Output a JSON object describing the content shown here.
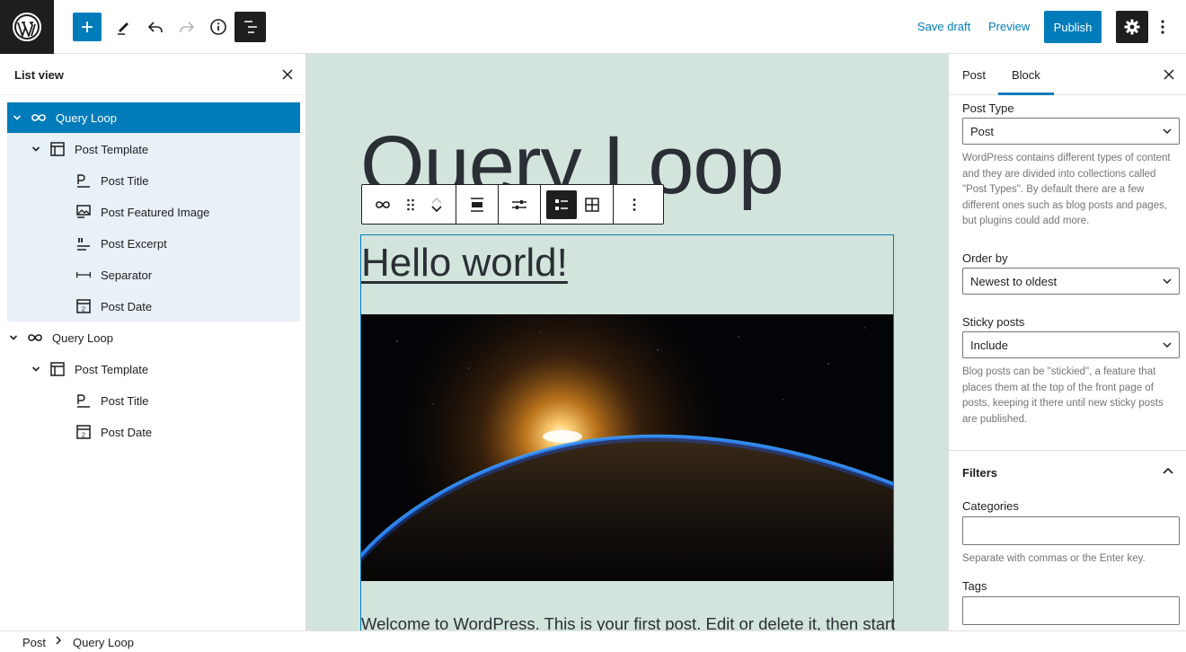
{
  "toolbar": {
    "save_draft": "Save draft",
    "preview": "Preview",
    "publish": "Publish"
  },
  "list_view": {
    "title": "List view",
    "items": [
      {
        "label": "Query Loop",
        "icon": "loop-icon",
        "level": 0,
        "expanded": true,
        "selected": true
      },
      {
        "label": "Post Template",
        "icon": "layout-icon",
        "level": 1,
        "expanded": true
      },
      {
        "label": "Post Title",
        "icon": "title-icon",
        "level": 2
      },
      {
        "label": "Post Featured Image",
        "icon": "image-icon",
        "level": 2
      },
      {
        "label": "Post Excerpt",
        "icon": "excerpt-icon",
        "level": 2
      },
      {
        "label": "Separator",
        "icon": "separator-icon",
        "level": 2
      },
      {
        "label": "Post Date",
        "icon": "date-icon",
        "level": 2
      },
      {
        "label": "Query Loop",
        "icon": "loop-icon",
        "level": 0,
        "expanded": true
      },
      {
        "label": "Post Template",
        "icon": "layout-icon",
        "level": 1,
        "expanded": true
      },
      {
        "label": "Post Title",
        "icon": "title-icon",
        "level": 2
      },
      {
        "label": "Post Date",
        "icon": "date-icon",
        "level": 2
      }
    ]
  },
  "canvas": {
    "page_title": "Query Loop",
    "post_title": "Hello world!",
    "excerpt": "Welcome to WordPress. This is your first post. Edit or delete it, then start"
  },
  "sidebar": {
    "tabs": [
      "Post",
      "Block"
    ],
    "active_tab": "Block",
    "post_type": {
      "label": "Post Type",
      "value": "Post",
      "help": "WordPress contains different types of content and they are divided into collections called \"Post Types\". By default there are a few different ones such as blog posts and pages, but plugins could add more."
    },
    "order_by": {
      "label": "Order by",
      "value": "Newest to oldest"
    },
    "sticky": {
      "label": "Sticky posts",
      "value": "Include",
      "help": "Blog posts can be \"stickied\", a feature that places them at the top of the front page of posts, keeping it there until new sticky posts are published."
    },
    "filters": {
      "title": "Filters",
      "categories_label": "Categories",
      "categories_help": "Separate with commas or the Enter key.",
      "tags_label": "Tags"
    }
  },
  "breadcrumb": [
    "Post",
    "Query Loop"
  ],
  "colors": {
    "accent": "#007cba",
    "dark": "#1e1e1e",
    "canvas_bg": "#d3e4dc",
    "selection_bg": "#e8f0f8"
  }
}
